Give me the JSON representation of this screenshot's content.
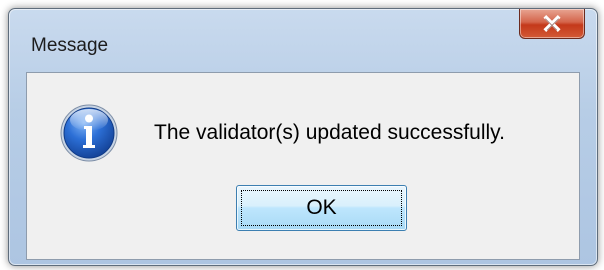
{
  "window": {
    "title": "Message"
  },
  "message": {
    "text": "The validator(s) updated successfully.",
    "icon": "information-icon"
  },
  "buttons": {
    "ok_label": "OK",
    "close_icon": "close-icon"
  },
  "colors": {
    "close_button": "#c4391b",
    "ok_button_border": "#3c7fb1",
    "info_icon_blue": "#1a55b8"
  }
}
